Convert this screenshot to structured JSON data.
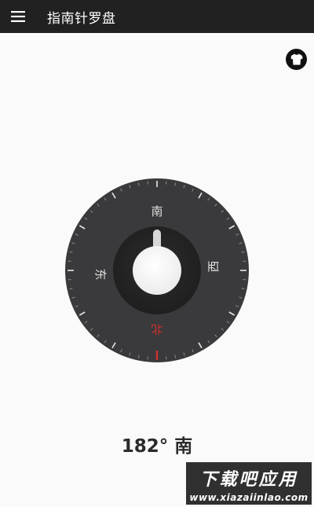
{
  "toolbar": {
    "title": "指南针罗盘",
    "background": "#212121"
  },
  "icons": {
    "menu": "hamburger-menu-icon",
    "skin": "shirt-icon"
  },
  "compass": {
    "heading_degrees": 182,
    "labels": {
      "south": "南",
      "east": "东",
      "west": "西",
      "north": "北"
    },
    "north_color": "#d32f2f",
    "dial_color": "#3a3a3c",
    "knob_color": "#f5f5f5"
  },
  "readout": {
    "degrees": "182°",
    "direction": "南"
  },
  "watermark": {
    "title": "下载吧应用",
    "url": "www.xiazaiinlao.com"
  }
}
